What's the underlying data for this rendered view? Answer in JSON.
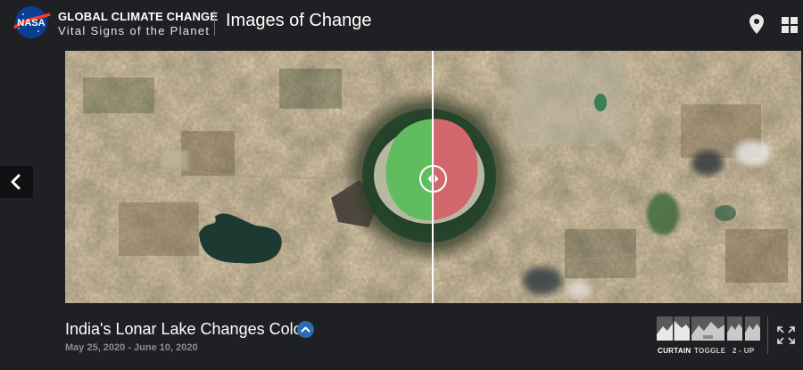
{
  "header": {
    "nasa_logo_text": "NASA",
    "brand_title": "GLOBAL CLIMATE CHANGE",
    "brand_subtitle": "Vital Signs of the Planet",
    "section_title": "Images of Change",
    "icons": {
      "location": "map-pin-icon",
      "menu": "grid-icon"
    }
  },
  "nav": {
    "prev_icon": "chevron-left-icon"
  },
  "viewer": {
    "mode": "curtain",
    "curtain_position_fraction": 0.5,
    "lake_color_before": "#5fbd5f",
    "lake_color_after": "#d2686e"
  },
  "caption": {
    "title": "India's Lonar Lake Changes Color",
    "dates": "May 25, 2020 - June 10, 2020",
    "expand_icon": "chevron-up-icon"
  },
  "view_modes": [
    {
      "label": "CURTAIN",
      "active": true
    },
    {
      "label": "TOGGLE",
      "active": false
    },
    {
      "label": "2 - UP",
      "active": false
    }
  ],
  "colors": {
    "background": "#1f2023",
    "accent": "#2b6cb0"
  },
  "fullscreen_icon": "fullscreen-icon"
}
